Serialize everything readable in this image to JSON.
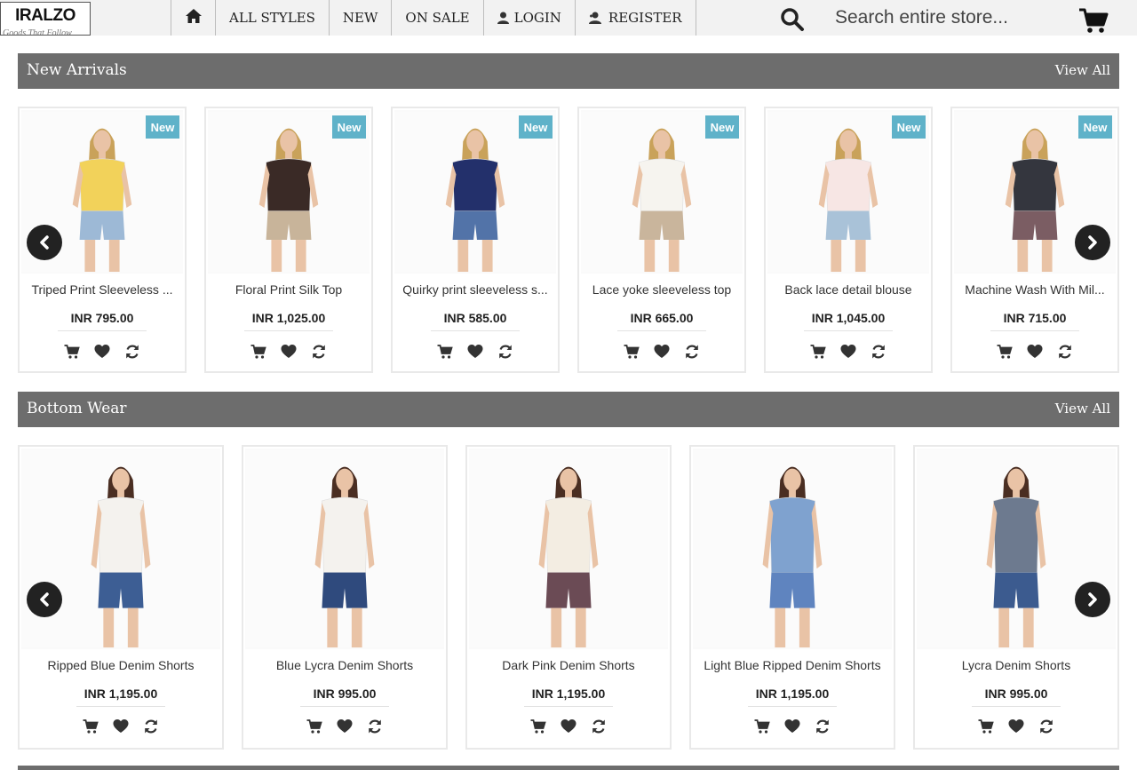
{
  "header": {
    "logo_text": "IRALZO",
    "logo_tagline": "Goods That Follow",
    "nav": {
      "all_styles": "ALL STYLES",
      "new": "NEW",
      "on_sale": "ON SALE",
      "login": "LOGIN",
      "register": "REGISTER"
    },
    "search_placeholder": "Search entire store..."
  },
  "new_arrivals": {
    "title": "New Arrivals",
    "view_all": "View All",
    "badge": "New",
    "products": [
      {
        "name": "Triped Print Sleeveless ...",
        "price": "INR 795.00",
        "top": "#f2d25a",
        "bottom": "#9db9d6",
        "hair": "#c9a25a"
      },
      {
        "name": "Floral Print Silk Top",
        "price": "INR 1,025.00",
        "top": "#3a2a26",
        "bottom": "#c8b49a",
        "hair": "#c9a25a"
      },
      {
        "name": "Quirky print sleeveless s...",
        "price": "INR 585.00",
        "top": "#23306b",
        "bottom": "#5273a8",
        "hair": "#c9a25a"
      },
      {
        "name": "Lace yoke sleeveless top",
        "price": "INR 665.00",
        "top": "#f6f4ef",
        "bottom": "#c9b59c",
        "hair": "#c9a25a"
      },
      {
        "name": "Back lace detail blouse",
        "price": "INR 1,045.00",
        "top": "#f7e6e4",
        "bottom": "#a9c2d8",
        "hair": "#c9a25a"
      },
      {
        "name": "Machine Wash With Mil...",
        "price": "INR 715.00",
        "top": "#34363e",
        "bottom": "#7b5d63",
        "hair": "#c9a25a"
      }
    ]
  },
  "bottom_wear": {
    "title": "Bottom Wear",
    "view_all": "View All",
    "products": [
      {
        "name": "Ripped Blue Denim Shorts",
        "price": "INR 1,195.00",
        "top": "#f4f2ee",
        "bottom": "#3d5e94",
        "hair": "#4a2e22"
      },
      {
        "name": "Blue Lycra Denim Shorts",
        "price": "INR 995.00",
        "top": "#f4f2ee",
        "bottom": "#2f4a7d",
        "hair": "#4a2e22"
      },
      {
        "name": "Dark Pink Denim Shorts",
        "price": "INR 1,195.00",
        "top": "#f3ede2",
        "bottom": "#6b4b55",
        "hair": "#4a2e22"
      },
      {
        "name": "Light Blue Ripped Denim Shorts",
        "price": "INR 1,195.00",
        "top": "#7fa2cf",
        "bottom": "#5f84bf",
        "hair": "#4a2e22"
      },
      {
        "name": "Lycra Denim Shorts",
        "price": "INR 995.00",
        "top": "#6d7a8f",
        "bottom": "#3c5b8f",
        "hair": "#4a2e22"
      }
    ]
  },
  "colors": {
    "section_bar": "#6d6d6d",
    "badge": "#5fb2c9",
    "arrow": "#222222"
  }
}
